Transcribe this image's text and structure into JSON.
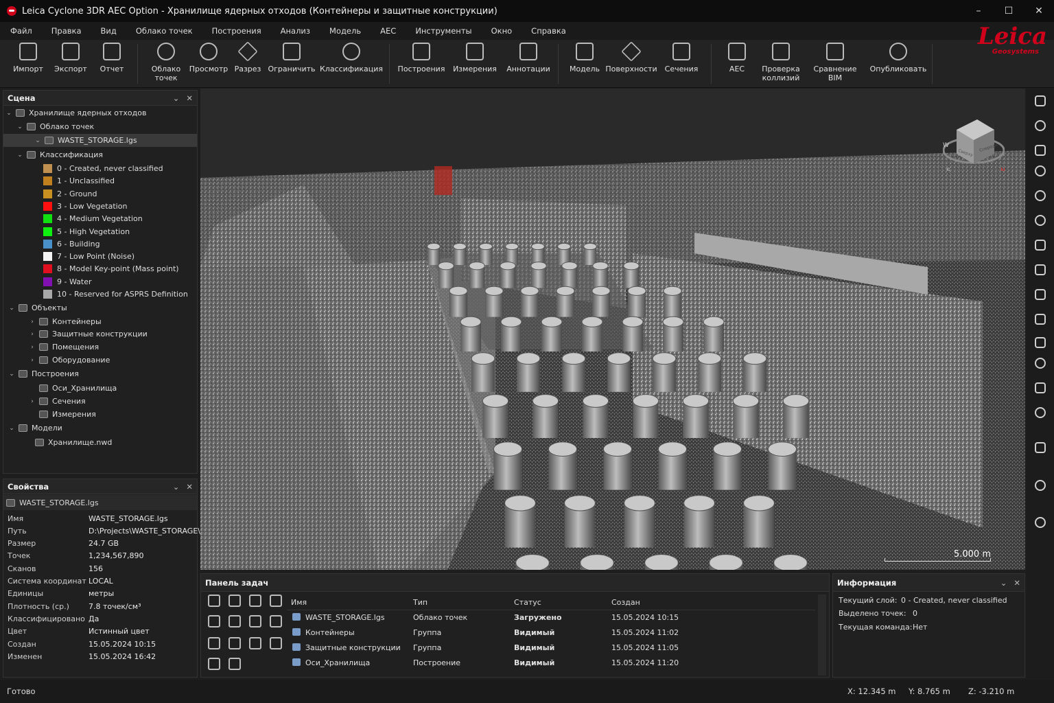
{
  "window": {
    "title": "Leica Cyclone 3DR AEC Option - Хранилище ядерных отходов (Контейнеры и защитные конструкции)",
    "minimize": "–",
    "maximize": "☐",
    "close": "✕"
  },
  "menu": [
    "Файл",
    "Правка",
    "Вид",
    "Облако точек",
    "Построения",
    "Анализ",
    "Модель",
    "AEC",
    "Инструменты",
    "Окно",
    "Справка"
  ],
  "toolbar": {
    "import": "Импорт",
    "export": "Экспорт",
    "report": "Отчет",
    "pointcloud1": "Облако",
    "pointcloud2": "точек",
    "view": "Просмотр",
    "section": "Разрез",
    "limit": "Ограничить",
    "classify": "Классификация",
    "constructions": "Построения",
    "measurements": "Измерения",
    "annotations": "Аннотации",
    "model": "Модель",
    "surfaces": "Поверхности",
    "sections": "Сечения",
    "aec": "AEC",
    "clash1": "Проверка",
    "clash2": "коллизий",
    "bim": "Сравнение BIM",
    "publish": "Опубликовать"
  },
  "brand": {
    "name": "Leica",
    "sub": "Geosystems"
  },
  "scene": {
    "title": "Сцена",
    "root": "Хранилище ядерных отходов",
    "pointcloud": "Облако точек",
    "file": "WASTE_STORAGE.lgs",
    "classification": "Классификация",
    "classes": [
      {
        "label": "0 - Created, never classified",
        "color": "#c09050"
      },
      {
        "label": "1 - Unclassified",
        "color": "#c08020"
      },
      {
        "label": "2 - Ground",
        "color": "#c89020"
      },
      {
        "label": "3 - Low Vegetation",
        "color": "#ff1010"
      },
      {
        "label": "4 - Medium Vegetation",
        "color": "#10e010"
      },
      {
        "label": "5 - High Vegetation",
        "color": "#10f010"
      },
      {
        "label": "6 - Building",
        "color": "#4a90c8"
      },
      {
        "label": "7 - Low Point (Noise)",
        "color": "#f4f4f4"
      },
      {
        "label": "8 - Model Key-point (Mass point)",
        "color": "#e01020"
      },
      {
        "label": "9 - Water",
        "color": "#8010b0"
      },
      {
        "label": "10 - Reserved for ASPRS Definition",
        "color": "#a8a8a8"
      }
    ],
    "objects": "Объекты",
    "object_items": [
      "Контейнеры",
      "Защитные конструкции",
      "Помещения",
      "Оборудование"
    ],
    "constructions": "Построения",
    "construction_items": [
      "Оси_Хранилища",
      "Сечения",
      "Измерения"
    ],
    "models": "Модели",
    "model_items": [
      "Хранилище.nwd"
    ]
  },
  "properties": {
    "title": "Свойства",
    "file": "WASTE_STORAGE.lgs",
    "rows": [
      {
        "k": "Имя",
        "v": "WASTE_STORAGE.lgs"
      },
      {
        "k": "Путь",
        "v": "D:\\Projects\\WASTE_STORAGE\\"
      },
      {
        "k": "Размер",
        "v": "24.7 GB"
      },
      {
        "k": "Точек",
        "v": "1,234,567,890"
      },
      {
        "k": "Сканов",
        "v": "156"
      },
      {
        "k": "Система координат",
        "v": "LOCAL"
      },
      {
        "k": "Единицы",
        "v": "метры"
      },
      {
        "k": "Плотность (ср.)",
        "v": "7.8 точек/см³"
      },
      {
        "k": "Классифицировано",
        "v": "Да"
      },
      {
        "k": "Цвет",
        "v": "Истинный цвет"
      },
      {
        "k": "Создан",
        "v": "15.05.2024 10:15"
      },
      {
        "k": "Изменен",
        "v": "15.05.2024 16:42"
      }
    ]
  },
  "viewport": {
    "scale_label": "5.000 m",
    "navcube": {
      "w": "W",
      "s": "S",
      "n": "N",
      "face1": "Сверху",
      "face2": "Спереди"
    }
  },
  "tasks": {
    "title": "Панель задач",
    "columns": [
      "Имя",
      "Тип",
      "Статус",
      "Создан"
    ],
    "rows": [
      {
        "name": "WASTE_STORAGE.lgs",
        "type": "Облако точек",
        "status": "Загружено",
        "created": "15.05.2024 10:15"
      },
      {
        "name": "Контейнеры",
        "type": "Группа",
        "status": "Видимый",
        "created": "15.05.2024 11:02"
      },
      {
        "name": "Защитные конструкции",
        "type": "Группа",
        "status": "Видимый",
        "created": "15.05.2024 11:05"
      },
      {
        "name": "Оси_Хранилища",
        "type": "Построение",
        "status": "Видимый",
        "created": "15.05.2024 11:20"
      }
    ]
  },
  "info": {
    "title": "Информация",
    "layer_label": "Текущий слой:",
    "layer_value": "0 - Created, never classified",
    "selected_label": "Выделено точек:",
    "selected_value": "0",
    "command_label": "Текущая команда:",
    "command_value": "Нет"
  },
  "status": {
    "text": "Готово",
    "x": "X: 12.345 m",
    "y": "Y: 8.765 m",
    "z": "Z: -3.210 m"
  }
}
